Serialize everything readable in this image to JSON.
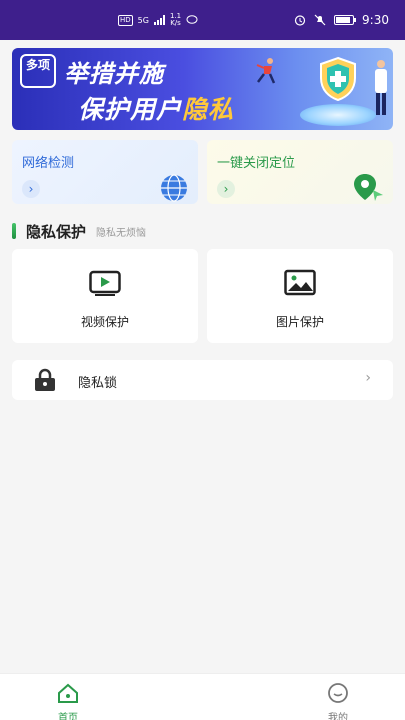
{
  "status_bar": {
    "network_badge": "HD",
    "signal_type": "5G",
    "speed_value": "1.1",
    "speed_unit": "K/s",
    "time": "9:30",
    "icons": [
      "alarm-icon",
      "mute-icon",
      "battery-icon"
    ]
  },
  "banner": {
    "tag": "多项",
    "line1": "举措并施",
    "line2_main": "保护用户",
    "line2_highlight": "隐私",
    "colors": {
      "background": "#3b3fd0",
      "highlight": "#ffc83a"
    }
  },
  "quick_cards": [
    {
      "title": "网络检测",
      "icon": "globe-icon"
    },
    {
      "title": "一键关闭定位",
      "icon": "location-icon"
    }
  ],
  "section": {
    "title": "隐私保护",
    "subtitle": "隐私无烦恼"
  },
  "features": [
    {
      "label": "视频保护",
      "icon": "video-icon"
    },
    {
      "label": "图片保护",
      "icon": "image-icon"
    }
  ],
  "privacy_lock": {
    "label": "隐私锁",
    "icon": "lock-icon"
  },
  "tabbar": {
    "tabs": [
      {
        "label": "首页",
        "icon": "home-icon",
        "active": true
      },
      {
        "label": "我的",
        "icon": "profile-icon",
        "active": false
      }
    ],
    "colors": {
      "active": "#2a9a4a",
      "inactive": "#777777"
    }
  }
}
